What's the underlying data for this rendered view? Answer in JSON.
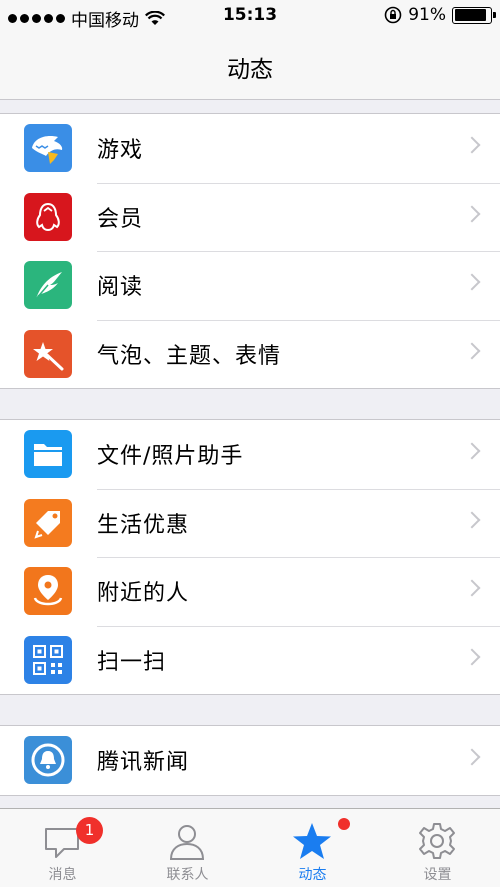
{
  "status": {
    "carrier": "中国移动",
    "time": "15:13",
    "battery": "91%",
    "battery_level": 0.91
  },
  "nav": {
    "title": "动态"
  },
  "groups": [
    {
      "items": [
        {
          "label": "游戏",
          "icon": "shark-game-icon",
          "color": "#3a8ee6"
        },
        {
          "label": "会员",
          "icon": "penguin-vip-icon",
          "color": "#d7161d"
        },
        {
          "label": "阅读",
          "icon": "feather-read-icon",
          "color": "#2bb57d"
        },
        {
          "label": "气泡、主题、表情",
          "icon": "magic-wand-icon",
          "color": "#e5532a"
        }
      ]
    },
    {
      "items": [
        {
          "label": "文件/照片助手",
          "icon": "folder-icon",
          "color": "#1a9af0"
        },
        {
          "label": "生活优惠",
          "icon": "tag-icon",
          "color": "#f47b1f"
        },
        {
          "label": "附近的人",
          "icon": "location-pin-icon",
          "color": "#f2761c"
        },
        {
          "label": "扫一扫",
          "icon": "qr-code-icon",
          "color": "#2d82e6"
        }
      ]
    },
    {
      "items": [
        {
          "label": "腾讯新闻",
          "icon": "bell-news-icon",
          "color": "#3b8fd8"
        }
      ]
    }
  ],
  "tabs": [
    {
      "label": "消息",
      "icon": "chat-bubble-icon",
      "badge": "1"
    },
    {
      "label": "联系人",
      "icon": "person-icon"
    },
    {
      "label": "动态",
      "icon": "star-icon",
      "active": true
    },
    {
      "label": "设置",
      "icon": "gear-icon"
    }
  ]
}
